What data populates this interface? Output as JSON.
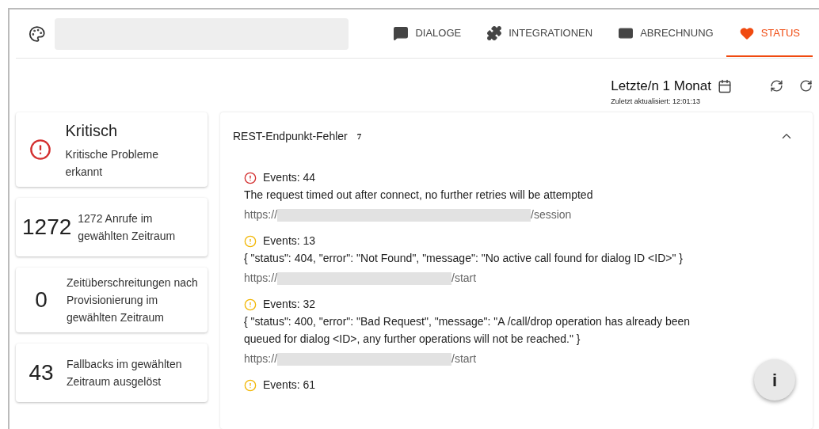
{
  "nav": {
    "tabs": [
      {
        "label": "DIALOGE",
        "selected": false
      },
      {
        "label": "INTEGRATIONEN",
        "selected": false
      },
      {
        "label": "ABRECHNUNG",
        "selected": false
      },
      {
        "label": "STATUS",
        "selected": true
      }
    ]
  },
  "timeframe": {
    "label": "Letzte/n 1 Monat",
    "updated": "Zuletzt aktualisiert: 12:01:13"
  },
  "summary": [
    {
      "kind": "status",
      "title": "Kritisch",
      "text": "Kritische Probleme erkannt"
    },
    {
      "kind": "count",
      "value": "1272",
      "text": "1272 Anrufe im gewählten Zeitraum"
    },
    {
      "kind": "count",
      "value": "0",
      "text": "Zeitüberschreitungen nach Provisionierung im gewählten Zeitraum"
    },
    {
      "kind": "count",
      "value": "43",
      "text": "Fallbacks im gewählten Zeitraum ausgelöst"
    }
  ],
  "panel": {
    "title": "REST-Endpunkt-Fehler",
    "count": "7",
    "expanded": true,
    "events": [
      {
        "kind": "critical",
        "events": "Events: 44",
        "message": "The request timed out after connect, no further retries will be attempted",
        "url_prefix": "https://",
        "url_suffix": "/session"
      },
      {
        "kind": "warning",
        "events": "Events: 13",
        "message": "{ \"status\": 404, \"error\": \"Not Found\", \"message\": \"No active call found for dialog ID <ID>\" }",
        "url_prefix": "https://",
        "url_suffix": "/start"
      },
      {
        "kind": "warning",
        "events": "Events: 32",
        "message": "{ \"status\": 400, \"error\": \"Bad Request\", \"message\": \"A /call/drop operation has already been queued for dialog <ID>, any further operations will not be reached.\" }",
        "url_prefix": "https://",
        "url_suffix": "/start"
      },
      {
        "kind": "warning",
        "events": "Events: 61"
      }
    ]
  },
  "fab": {
    "label": "i"
  }
}
